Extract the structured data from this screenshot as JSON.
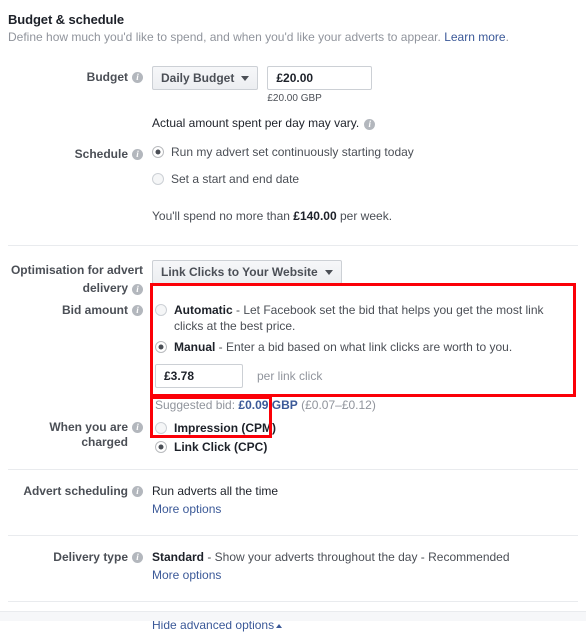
{
  "header": {
    "title": "Budget & schedule",
    "description": "Define how much you'd like to spend, and when you'd like your adverts to appear.",
    "learn_more": "Learn more",
    "description_end": "."
  },
  "budget": {
    "label": "Budget",
    "type_value": "Daily Budget",
    "amount_value": "£20.00",
    "currency_note": "£20.00 GBP",
    "vary_note": "Actual amount spent per day may vary."
  },
  "schedule": {
    "label": "Schedule",
    "options": [
      {
        "label": "Run my advert set continuously starting today",
        "selected": true
      },
      {
        "label": "Set a start and end date",
        "selected": false
      }
    ],
    "spend_prefix": "You'll spend no more than ",
    "spend_amount": "£140.00",
    "spend_suffix": " per week."
  },
  "optimisation": {
    "label_line1": "Optimisation for advert",
    "label_line2": "delivery",
    "value": "Link Clicks to Your Website"
  },
  "bid_amount": {
    "label": "Bid amount",
    "automatic": {
      "title": "Automatic",
      "description": " - Let Facebook set the bid that helps you get the most link clicks at the best price.",
      "selected": false
    },
    "manual": {
      "title": "Manual",
      "description": " - Enter a bid based on what link clicks are worth to you.",
      "selected": true
    },
    "bid_value": "£3.78",
    "bid_unit": "per link click",
    "suggested_prefix": "Suggested bid: ",
    "suggested_value": "£0.09 GBP",
    "suggested_range": " (£0.07–£0.12)"
  },
  "when_charged": {
    "label": "When you are charged",
    "options": [
      {
        "label": "Impression (CPM)",
        "selected": false
      },
      {
        "label": "Link Click (CPC)",
        "selected": true
      }
    ]
  },
  "advert_scheduling": {
    "label": "Advert scheduling",
    "value": "Run adverts all the time",
    "more_options": "More options"
  },
  "delivery_type": {
    "label": "Delivery type",
    "value_bold": "Standard",
    "value_rest": " - Show your adverts throughout the day - Recommended",
    "more_options": "More options"
  },
  "footer": {
    "hide_advanced": "Hide advanced options"
  },
  "colors": {
    "link": "#3b5998",
    "annotation": "#fb0007",
    "label": "#4b4f56",
    "muted": "#90949c"
  }
}
